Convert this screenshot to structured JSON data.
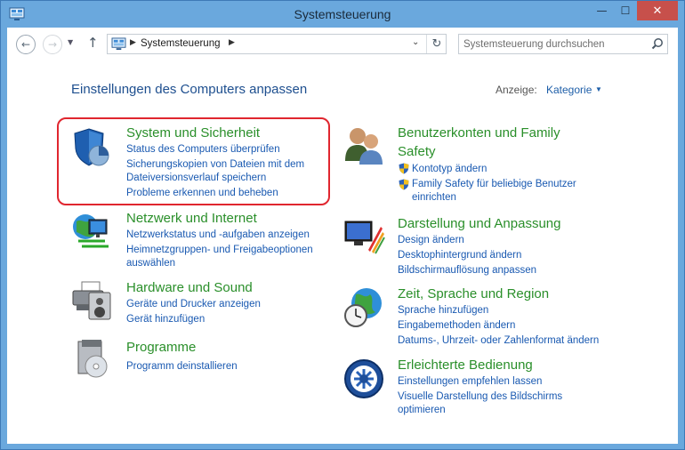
{
  "window": {
    "title": "Systemsteuerung",
    "controls": {
      "minimize": "—",
      "maximize": "☐",
      "close": "✕"
    }
  },
  "address": {
    "path_label": "Systemsteuerung",
    "search_placeholder": "Systemsteuerung durchsuchen"
  },
  "header": {
    "title": "Einstellungen des Computers anpassen",
    "view_label": "Anzeige:",
    "view_value": "Kategorie"
  },
  "categories": [
    {
      "title": "System und Sicherheit",
      "links": [
        "Status des Computers überprüfen",
        "Sicherungskopien von Dateien mit dem Dateiversionsverlauf speichern",
        "Probleme erkennen und beheben"
      ]
    },
    {
      "title": "Netzwerk und Internet",
      "links": [
        "Netzwerkstatus und -aufgaben anzeigen",
        "Heimnetzgruppen- und Freigabeoptionen auswählen"
      ]
    },
    {
      "title": "Hardware und Sound",
      "links": [
        "Geräte und Drucker anzeigen",
        "Gerät hinzufügen"
      ]
    },
    {
      "title": "Programme",
      "links": [
        "Programm deinstallieren"
      ]
    },
    {
      "title": "Benutzerkonten und Family Safety",
      "links": [
        "Kontotyp ändern",
        "Family Safety für beliebige Benutzer einrichten"
      ]
    },
    {
      "title": "Darstellung und Anpassung",
      "links": [
        "Design ändern",
        "Desktophintergrund ändern",
        "Bildschirmauflösung anpassen"
      ]
    },
    {
      "title": "Zeit, Sprache und Region",
      "links": [
        "Sprache hinzufügen",
        "Eingabemethoden ändern",
        "Datums-, Uhrzeit- oder Zahlenformat ändern"
      ]
    },
    {
      "title": "Erleichterte Bedienung",
      "links": [
        "Einstellungen empfehlen lassen",
        "Visuelle Darstellung des Bildschirms optimieren"
      ]
    }
  ],
  "colors": {
    "titlebar": "#6aa8dd",
    "category_title": "#2a8f2a",
    "link": "#1959b1",
    "highlight": "#e0262f"
  }
}
